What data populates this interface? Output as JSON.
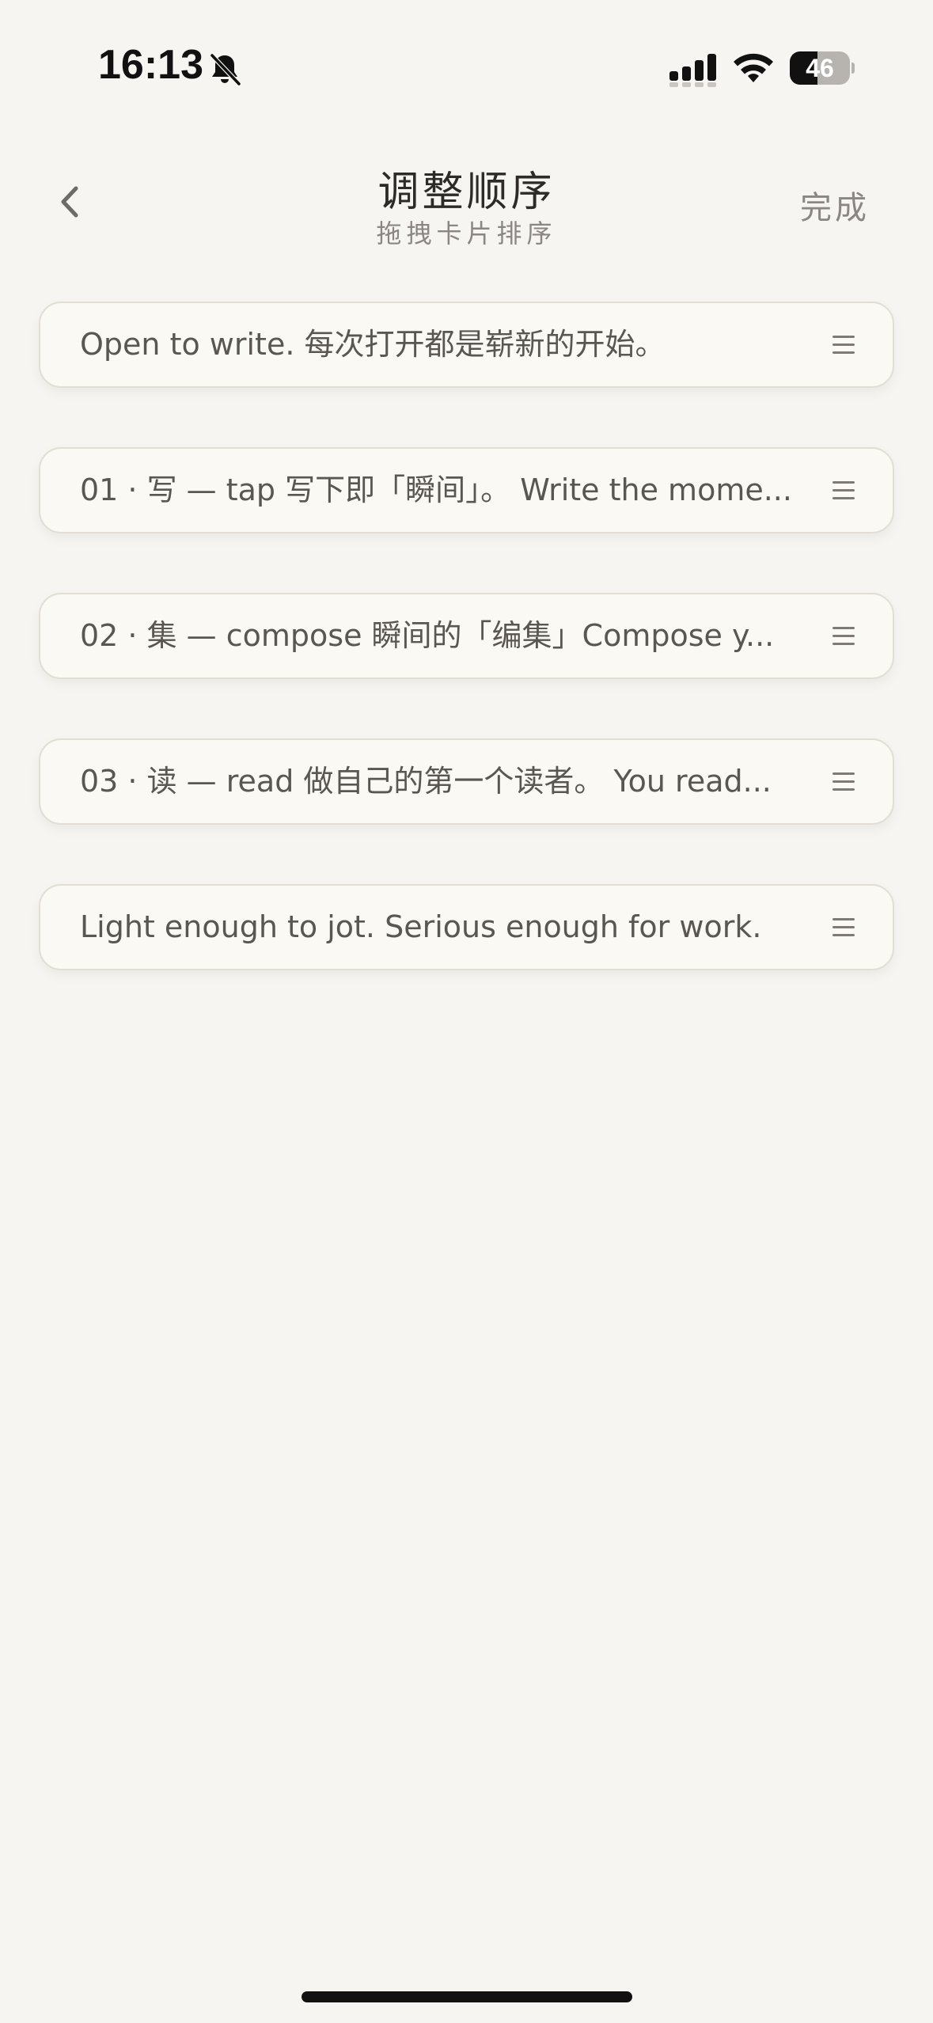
{
  "status_bar": {
    "time": "16:13",
    "battery_level": "46",
    "battery_fraction": 0.46
  },
  "header": {
    "back_icon": "chevron-left-icon",
    "title": "调整顺序",
    "subtitle": "拖拽卡片排序",
    "done_label": "完成"
  },
  "cards": [
    {
      "text": "Open to write. 每次打开都是崭新的开始。",
      "handle_icon": "drag-handle-icon"
    },
    {
      "text": "01 · 写 — tap 写下即「瞬间」。 Write the mome...",
      "handle_icon": "drag-handle-icon"
    },
    {
      "text": "02 · 集 — compose 瞬间的「编集」Compose y...",
      "handle_icon": "drag-handle-icon"
    },
    {
      "text": "03 · 读 — read 做自己的第一个读者。 You read...",
      "handle_icon": "drag-handle-icon"
    },
    {
      "text": "Light enough to jot. Serious enough for work.",
      "handle_icon": "drag-handle-icon"
    }
  ],
  "colors": {
    "background": "#f6f5f1",
    "card_background": "#fbf9f4",
    "card_border": "#e3ded4",
    "text_primary": "#2d2a27",
    "text_secondary": "#8b8681"
  }
}
